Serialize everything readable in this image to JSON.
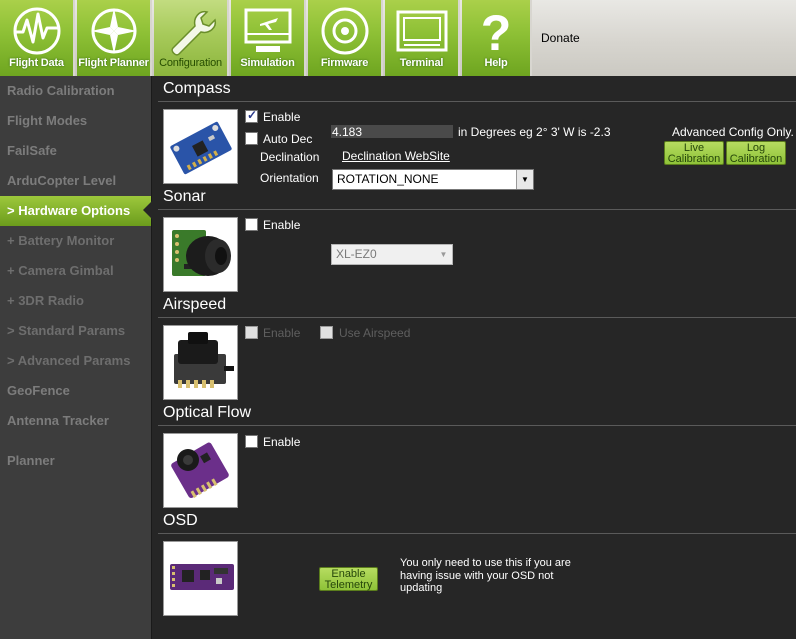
{
  "toolbar": {
    "buttons": [
      {
        "label": "Flight Data",
        "icon": "flight-data-icon"
      },
      {
        "label": "Flight Planner",
        "icon": "flight-planner-icon"
      },
      {
        "label": "Configuration",
        "icon": "wrench-icon"
      },
      {
        "label": "Simulation",
        "icon": "simulation-icon"
      },
      {
        "label": "Firmware",
        "icon": "firmware-disc-icon"
      },
      {
        "label": "Terminal",
        "icon": "terminal-icon"
      },
      {
        "label": "Help",
        "icon": "help-icon"
      }
    ],
    "active": "Configuration",
    "donate": "Donate"
  },
  "sidebar": {
    "items": [
      {
        "label": "Radio Calibration"
      },
      {
        "label": "Flight Modes"
      },
      {
        "label": "FailSafe"
      },
      {
        "label": "ArduCopter Level"
      },
      {
        "label": "> Hardware Options",
        "active": true
      },
      {
        "label": "+ Battery Monitor"
      },
      {
        "label": "+ Camera Gimbal"
      },
      {
        "label": "+ 3DR Radio"
      },
      {
        "label": "> Standard Params"
      },
      {
        "label": "> Advanced Params"
      },
      {
        "label": "GeoFence"
      },
      {
        "label": "Antenna Tracker"
      },
      {
        "label": "Planner"
      }
    ]
  },
  "compass": {
    "title": "Compass",
    "enable_label": "Enable",
    "enable_checked": true,
    "auto_dec_label": "Auto Dec",
    "auto_dec_checked": false,
    "declination_label": "Declination",
    "declination_value": "4.183",
    "declination_hint": "in Degrees eg 2° 3' W is -2.3",
    "declination_link": "Declination WebSite",
    "orientation_label": "Orientation",
    "orientation_value": "ROTATION_NONE",
    "advanced_label": "Advanced Config Only.",
    "live_calibration": "Live Calibration",
    "log_calibration": "Log Calibration"
  },
  "sonar": {
    "title": "Sonar",
    "enable_label": "Enable",
    "enable_checked": false,
    "sensor_value": "XL-EZ0"
  },
  "airspeed": {
    "title": "Airspeed",
    "enable_label": "Enable",
    "use_airspeed_label": "Use Airspeed"
  },
  "optical_flow": {
    "title": "Optical Flow",
    "enable_label": "Enable",
    "enable_checked": false
  },
  "osd": {
    "title": "OSD",
    "enable_telemetry": "Enable Telemetry",
    "note": "You only need to use this if you are having issue with your OSD not updating"
  },
  "colors": {
    "toolbar_green": "#8dc035",
    "sidebar_bg": "#3d3d3d",
    "content_bg": "#262626",
    "active_item": "#7fb22a"
  }
}
